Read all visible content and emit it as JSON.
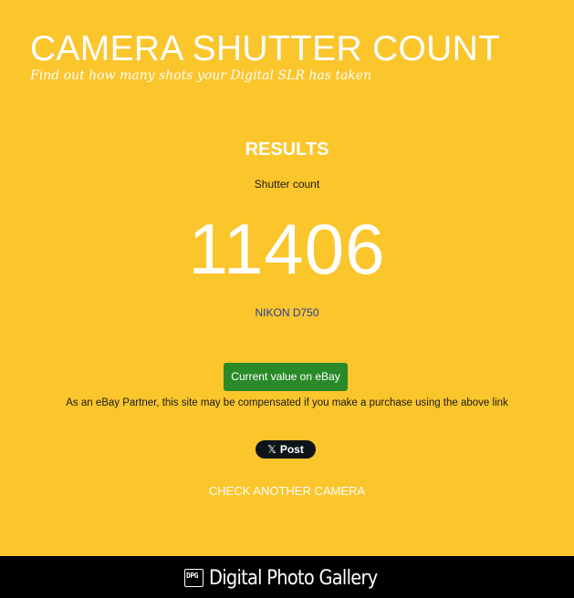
{
  "header": {
    "title": "CAMERA SHUTTER COUNT",
    "tagline": "Find out how many shots your Digital SLR has taken"
  },
  "results": {
    "heading": "RESULTS",
    "count_label": "Shutter count",
    "count_value": "11406",
    "camera_model": "NIKON D750"
  },
  "ebay": {
    "button_label": "Current value on eBay",
    "disclaimer": "As an eBay Partner, this site may be compensated if you make a purchase using the above link"
  },
  "share": {
    "x_logo": "𝕏",
    "post_label": "Post"
  },
  "actions": {
    "check_another_label": "CHECK ANOTHER CAMERA"
  },
  "footer": {
    "logo_mark": "DPG",
    "brand_name": "Digital Photo Gallery"
  },
  "colors": {
    "background": "#fbc52c",
    "ebay_button": "#2a8a2a",
    "footer": "#000000",
    "camera_model_text": "#2a3aa0"
  }
}
